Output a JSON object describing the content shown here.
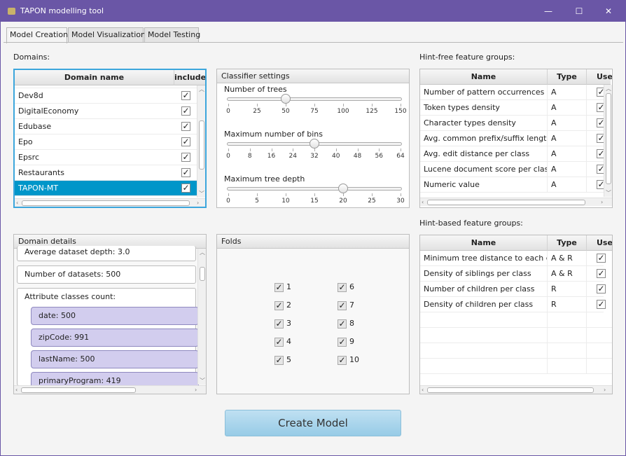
{
  "window": {
    "title": "TAPON modelling tool"
  },
  "window_controls": {
    "minimize": "—",
    "maximize": "☐",
    "close": "✕"
  },
  "tabs": [
    "Model Creation",
    "Model Visualization",
    "Model Testing"
  ],
  "domains": {
    "label": "Domains:",
    "col_name": "Domain name",
    "col_include": "include",
    "rows": [
      {
        "name": "Dev8d",
        "checked": true
      },
      {
        "name": "DigitalEconomy",
        "checked": true
      },
      {
        "name": "Edubase",
        "checked": true
      },
      {
        "name": "Epo",
        "checked": true
      },
      {
        "name": "Epsrc",
        "checked": true
      },
      {
        "name": "Restaurants",
        "checked": true
      },
      {
        "name": "TAPON-MT",
        "checked": true,
        "selected": true
      }
    ]
  },
  "classifier": {
    "title": "Classifier settings",
    "sliders": [
      {
        "label": "Number of trees",
        "ticks": [
          "0",
          "25",
          "50",
          "75",
          "100",
          "125",
          "150"
        ],
        "min": 0,
        "max": 150,
        "value": 50
      },
      {
        "label": "Maximum number of bins",
        "ticks": [
          "0",
          "8",
          "16",
          "24",
          "32",
          "40",
          "48",
          "56",
          "64"
        ],
        "min": 0,
        "max": 64,
        "value": 32
      },
      {
        "label": "Maximum tree depth",
        "ticks": [
          "0",
          "5",
          "10",
          "15",
          "20",
          "25",
          "30"
        ],
        "min": 0,
        "max": 30,
        "value": 20
      }
    ]
  },
  "hint_free": {
    "label": "Hint-free feature groups:",
    "col_name": "Name",
    "col_type": "Type",
    "col_use": "Use",
    "rows": [
      {
        "name": "Number of pattern occurrences",
        "type": "A",
        "use": true
      },
      {
        "name": "Token types density",
        "type": "A",
        "use": true
      },
      {
        "name": "Character types density",
        "type": "A",
        "use": true
      },
      {
        "name": "Avg. common prefix/suffix length ...",
        "type": "A",
        "use": true
      },
      {
        "name": "Avg. edit distance per class",
        "type": "A",
        "use": true
      },
      {
        "name": "Lucene document score per class",
        "type": "A",
        "use": true
      },
      {
        "name": "Numeric value",
        "type": "A",
        "use": true
      }
    ]
  },
  "hint_based": {
    "label": "Hint-based feature groups:",
    "col_name": "Name",
    "col_type": "Type",
    "col_use": "Use",
    "rows": [
      {
        "name": "Minimum tree distance to each cl...",
        "type": "A & R",
        "use": true
      },
      {
        "name": "Density of siblings per class",
        "type": "A & R",
        "use": true
      },
      {
        "name": "Number of children per class",
        "type": "R",
        "use": true
      },
      {
        "name": "Density of children per class",
        "type": "R",
        "use": true
      }
    ]
  },
  "domain_details": {
    "title": "Domain details",
    "avg_depth": "Average dataset depth: 3.0",
    "num_datasets": "Number of datasets: 500",
    "attr_header": "Attribute classes count:",
    "attributes": [
      "date: 500",
      "zipCode: 991",
      "lastName: 500",
      "primaryProgram: 419"
    ]
  },
  "folds": {
    "title": "Folds",
    "items": [
      {
        "label": "1",
        "checked": true
      },
      {
        "label": "2",
        "checked": true
      },
      {
        "label": "3",
        "checked": true
      },
      {
        "label": "4",
        "checked": true
      },
      {
        "label": "5",
        "checked": true
      },
      {
        "label": "6",
        "checked": true
      },
      {
        "label": "7",
        "checked": true
      },
      {
        "label": "8",
        "checked": true
      },
      {
        "label": "9",
        "checked": true
      },
      {
        "label": "10",
        "checked": true
      }
    ]
  },
  "create_button": "Create Model",
  "colors": {
    "titlebar": "#6a56a6",
    "selection": "#0096c9",
    "focus": "#3ca6dc",
    "attr_item": "#d2cdee",
    "button": "#a8d4ea"
  }
}
